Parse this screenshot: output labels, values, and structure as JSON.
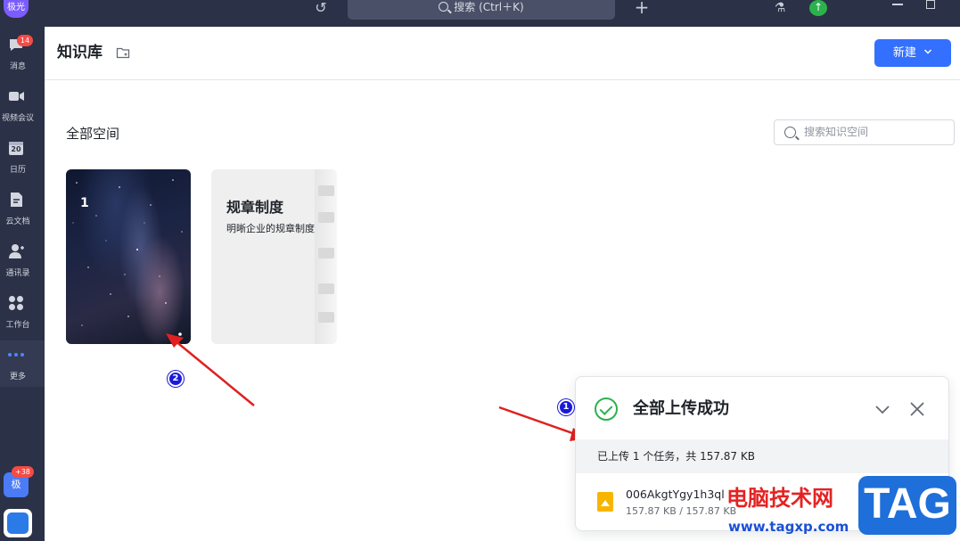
{
  "titlebar": {
    "app_avatar": "极光",
    "search_placeholder": "搜索 (Ctrl＋K)"
  },
  "sidebar": {
    "items": [
      {
        "label": "消息",
        "badge": "14",
        "icon": "chat-bubble-icon"
      },
      {
        "label": "视频会议",
        "icon": "video-camera-icon"
      },
      {
        "label": "日历",
        "day": "20",
        "icon": "calendar-icon"
      },
      {
        "label": "云文档",
        "icon": "cloud-doc-icon"
      },
      {
        "label": "通讯录",
        "icon": "contacts-icon"
      },
      {
        "label": "工作台",
        "icon": "workplace-grid-icon"
      },
      {
        "label": "更多",
        "icon": "more-dots-icon",
        "active": true
      }
    ],
    "jiguang_app": {
      "label": "极",
      "badge": "+38"
    }
  },
  "header": {
    "title": "知识库",
    "new_button": "新建"
  },
  "spaces": {
    "section_title": "全部空间",
    "search_placeholder": "搜索知识空间",
    "cards": [
      {
        "name": "1",
        "cover": "galaxy-photo"
      },
      {
        "name": "规章制度",
        "description": "明晰企业的规章制度",
        "cover": "light-gray-document"
      }
    ]
  },
  "annotations": {
    "marker_1": "1",
    "marker_2": "2",
    "arrow_color": "#e02020"
  },
  "upload_panel": {
    "title": "全部上传成功",
    "summary": "已上传 1 个任务，共 157.87 KB",
    "file": {
      "name": "006AkgtYgy1h3ql",
      "size": "157.87 KB / 157.87 KB"
    }
  },
  "watermark": {
    "site_name": "电脑技术网",
    "url": "www.tagxp.com",
    "logo": "TAG"
  },
  "colors": {
    "sidebar_bg": "#2b3147",
    "primary_blue": "#3370ff",
    "success_green": "#2bb24c",
    "badge_red": "#f54a45"
  }
}
